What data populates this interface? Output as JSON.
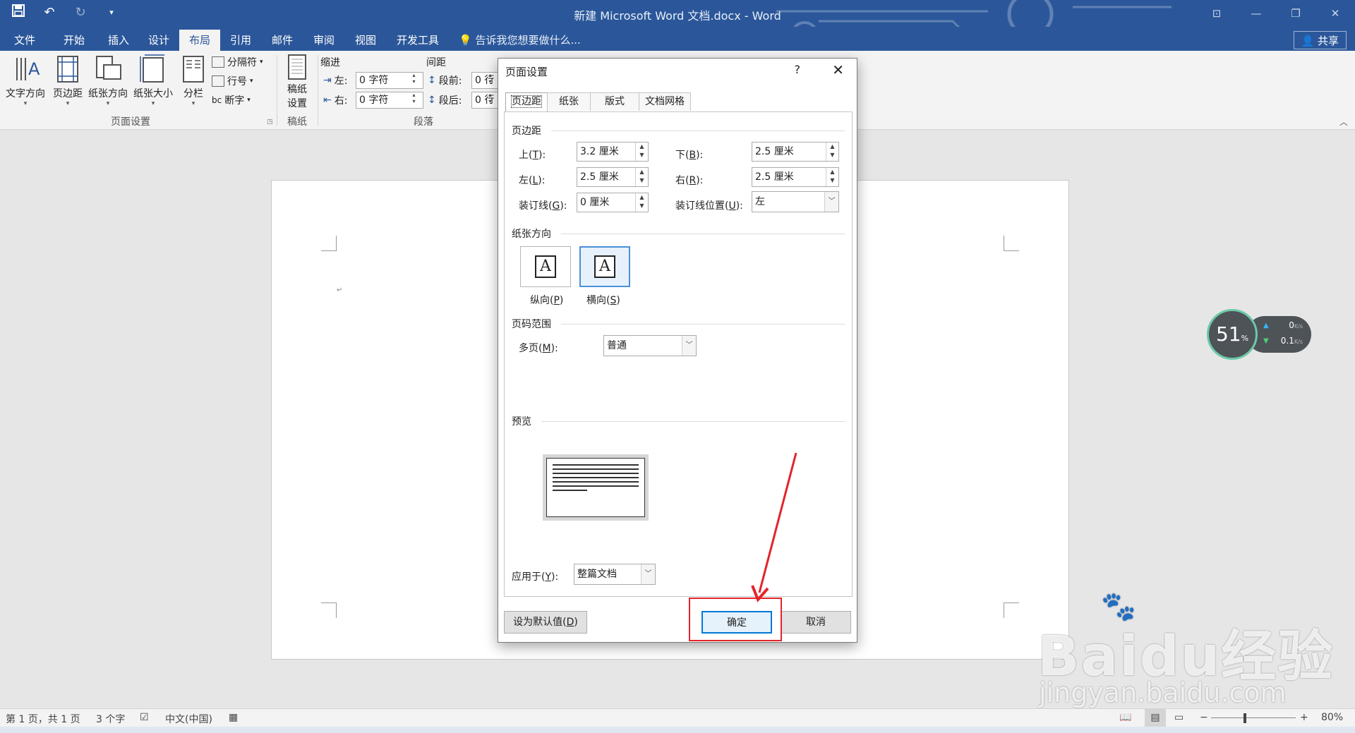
{
  "window": {
    "title": "新建 Microsoft Word 文档.docx - Word",
    "qat": {
      "save_icon": "save-icon",
      "undo_icon": "undo-icon",
      "redo_icon": "redo-icon",
      "customize_icon": "customize-qat-icon"
    }
  },
  "tabs": [
    {
      "label": "文件"
    },
    {
      "label": "开始"
    },
    {
      "label": "插入"
    },
    {
      "label": "设计"
    },
    {
      "label": "布局"
    },
    {
      "label": "引用"
    },
    {
      "label": "邮件"
    },
    {
      "label": "审阅"
    },
    {
      "label": "视图"
    },
    {
      "label": "开发工具"
    }
  ],
  "tellme": "告诉我您想要做什么...",
  "share": "共享",
  "ribbon": {
    "page_setup": {
      "text_direction": "文字方向",
      "margins": "页边距",
      "orientation": "纸张方向",
      "size": "纸张大小",
      "columns": "分栏",
      "breaks": "分隔符",
      "line_numbers": "行号",
      "hyphenation": "断字",
      "group_label": "页面设置"
    },
    "draft_paper": {
      "label": "稿纸\n设置",
      "label1": "稿纸",
      "label2": "设置",
      "group_label": "稿纸"
    },
    "paragraph": {
      "indent_title": "缩进",
      "spacing_title": "间距",
      "indent_left_label": "左:",
      "indent_left_value": "0 字符",
      "indent_right_label": "右:",
      "indent_right_value": "0 字符",
      "before_label": "段前:",
      "before_value": "0 行",
      "after_label": "段后:",
      "after_value": "0 行",
      "group_label": "段落"
    }
  },
  "dialog": {
    "title": "页面设置",
    "help": "?",
    "close": "✕",
    "tabs": [
      "页边距",
      "纸张",
      "版式",
      "文档网格"
    ],
    "margins_section": "页边距",
    "top_label": "上(",
    "top_key": "T",
    "top_value": "3.2 厘米",
    "bottom_label": "下(",
    "bottom_key": "B",
    "bottom_value": "2.5 厘米",
    "left_label": "左(",
    "left_key": "L",
    "left_value": "2.5 厘米",
    "right_label": "右(",
    "right_key": "R",
    "right_value": "2.5 厘米",
    "gutter_label": "装订线(",
    "gutter_key": "G",
    "gutter_value": "0 厘米",
    "gutter_pos_label": "装订线位置(",
    "gutter_pos_key": "U",
    "gutter_pos_value": "左",
    "orientation_section": "纸张方向",
    "portrait_label": "纵向(",
    "portrait_key": "P",
    "landscape_label": "横向(",
    "landscape_key": "S",
    "orientation_glyph": "A",
    "pages_section": "页码范围",
    "multiple_pages_label": "多页(",
    "multiple_pages_key": "M",
    "multiple_pages_value": "普通",
    "preview_section": "预览",
    "apply_to_label": "应用于(",
    "apply_to_key": "Y",
    "apply_to_value": "整篇文档",
    "set_default": "设为默认值(",
    "set_default_key": "D",
    "ok": "确定",
    "cancel": "取消"
  },
  "status": {
    "page": "第 1 页，共 1 页",
    "words": "3 个字",
    "language": "中文(中国)",
    "zoom": "80%"
  },
  "speed_widget": {
    "percent": "51",
    "percent_sign": "%",
    "up": "0",
    "down": "0.1",
    "unit": "K/s"
  },
  "watermark": {
    "line1": "Bai",
    "line2": "du经验",
    "line3": "jingyan.baidu.com"
  },
  "colors": {
    "accent": "#2b579a",
    "highlight": "#e3242b",
    "primary_button": "#0078d7"
  }
}
